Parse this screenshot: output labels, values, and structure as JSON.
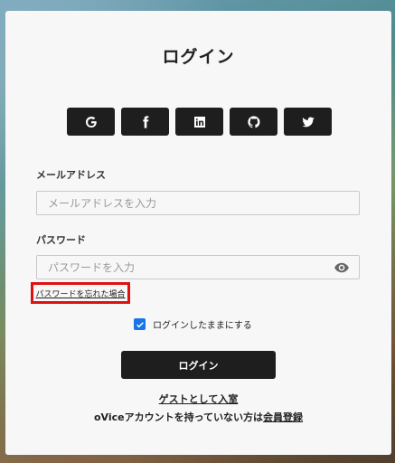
{
  "title": "ログイン",
  "social": [
    {
      "name": "google",
      "icon": "google-icon"
    },
    {
      "name": "facebook",
      "icon": "facebook-icon"
    },
    {
      "name": "linkedin",
      "icon": "linkedin-icon"
    },
    {
      "name": "github",
      "icon": "github-icon"
    },
    {
      "name": "twitter",
      "icon": "twitter-icon"
    }
  ],
  "email": {
    "label": "メールアドレス",
    "placeholder": "メールアドレスを入力",
    "value": ""
  },
  "password": {
    "label": "パスワード",
    "placeholder": "パスワードを入力",
    "value": ""
  },
  "forgot_link": "パスワードを忘れた場合",
  "remember": {
    "label": "ログインしたままにする",
    "checked": true
  },
  "login_button": "ログイン",
  "guest_link": "ゲストとして入室",
  "no_account": {
    "text": "oViceアカウントを持っていない方は",
    "link": "会員登録"
  },
  "colors": {
    "highlight_border": "#e01010",
    "checkbox": "#1a73e8",
    "button": "#1e1e1e"
  }
}
